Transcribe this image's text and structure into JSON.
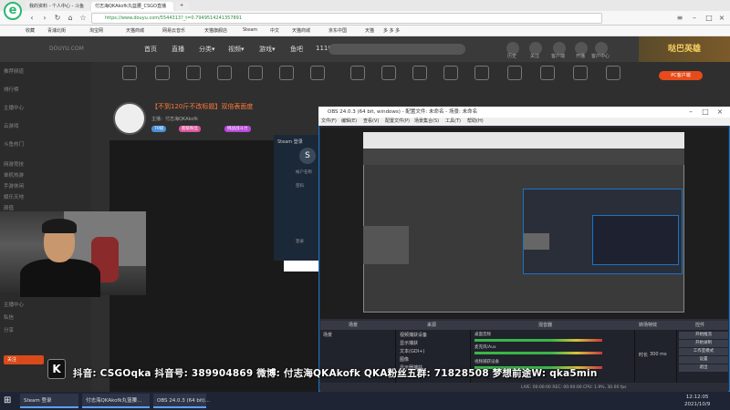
{
  "browser": {
    "tabs": [
      "我的资料 - 个人中心 - 斗鱼",
      "付志海QKAkofk丸篮腰_CSGO直播",
      ""
    ],
    "address": "https://www.douyu.com/5544313?_t=0.7949514241357891",
    "bookmarks": [
      "收藏",
      "青浦北街",
      "淘宝网",
      "天猫商城",
      "网易云音乐",
      "天猫旗舰店",
      "Steam",
      "中文",
      "天猫商城",
      "京东中国",
      "天猫",
      "多 多 多"
    ]
  },
  "douyu": {
    "logo": "DOUYU.COM",
    "nav": [
      "首页",
      "直播",
      "分类▾",
      "视频▾",
      "游戏▾",
      "鱼吧",
      "1110"
    ],
    "header_icons": [
      "历史",
      "关注",
      "客户端",
      "开播",
      "客户中心"
    ],
    "banner": "哒巴英雄",
    "categories": [
      "",
      "",
      "",
      "",
      "",
      "",
      "",
      "",
      "",
      "",
      "",
      "",
      "",
      "",
      "",
      "",
      "",
      ""
    ],
    "pc_button": "PC客户端",
    "sidebar": [
      "推荐频道",
      "排行榜",
      "主播中心",
      "云游戏",
      "斗鱼热门",
      "",
      "网游竞技",
      "单机热游",
      "手游休闲",
      "娱乐天地",
      "颜值",
      "科技文化",
      "",
      "主播中心",
      "私信",
      "分享"
    ],
    "favorite": "关注",
    "room": {
      "title": "【不到120斤不改标题】双倍表面度",
      "subtitle": "主播：付志海QKAkofk",
      "tags": [
        "70级",
        "超级粉丝",
        "",
        "挑战战斗力"
      ]
    },
    "steam": {
      "title": "Steam 登录",
      "logo": "S",
      "labels": [
        "帐户名称",
        "密码",
        "",
        "",
        "登录"
      ]
    }
  },
  "obs": {
    "title": "OBS 24.0.3 (64 bit, windows) - 配置文件: 未命名 - 场景: 未命名",
    "menu": [
      "文件(F)",
      "编辑(E)",
      "查看(V)",
      "配置文件(P)",
      "场景集合(S)",
      "工具(T)",
      "帮助(H)"
    ],
    "docks": [
      "场景",
      "来源",
      "混音器",
      "转场特效",
      "控件"
    ],
    "scene": "场景",
    "sources": [
      "视频捕获设备",
      "显示捕获",
      "文本(GDI+)",
      "图像",
      "显示器捕获"
    ],
    "mixer": [
      "桌面音频",
      "麦克风/Aux",
      "视频捕获设备"
    ],
    "transition_label": "时长",
    "transition_value": "300 ms",
    "controls": [
      "开始推流",
      "开始录制",
      "工作室模式",
      "设置",
      "退出"
    ],
    "status": "LIVE: 00:00:00   REC: 00:00:00   CPU: 1.9%, 30.00 fps"
  },
  "overlay_text": "抖音: CSGOqka  抖音号: 389904869  微博: 付志海QKAkofk  QKA粉丝五群: 71828508  梦想前途W: qka5min",
  "overlay_logo": "K",
  "taskbar": {
    "items": [
      "Steam 登录",
      "付志海QKAkofk丸篮腰...",
      "OBS 24.0.3 (64 bit)..."
    ],
    "clock_time": "12:12:05",
    "clock_date": "2021/10/9"
  }
}
